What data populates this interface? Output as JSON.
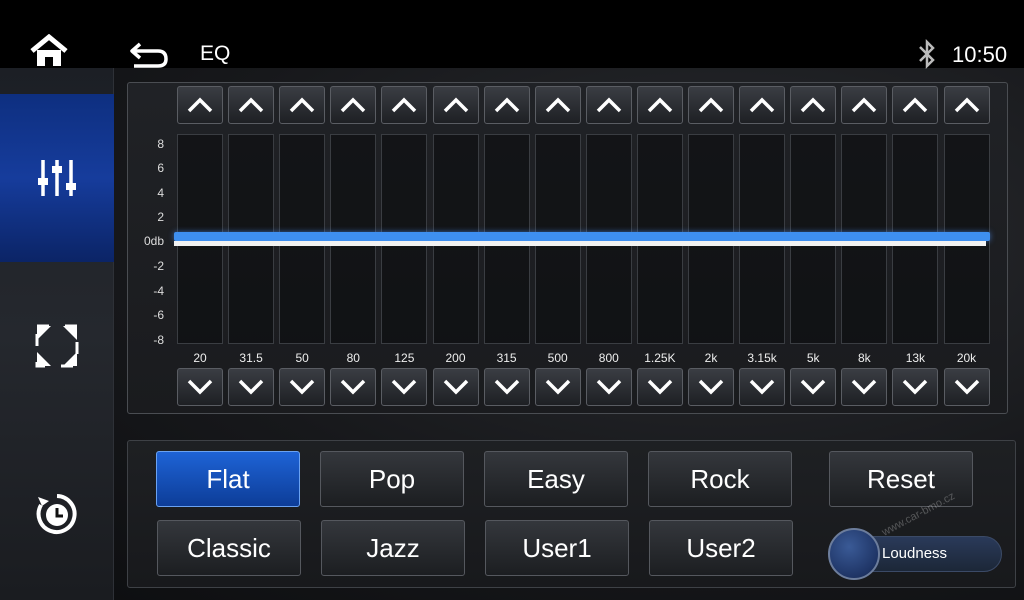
{
  "header": {
    "title": "EQ",
    "time": "10:50",
    "home_icon": "home-icon",
    "back_icon": "back-arrow-icon",
    "bluetooth_icon": "bluetooth-icon"
  },
  "sidebar": {
    "items": [
      {
        "icon": "equalizer-sliders-icon",
        "active": true
      },
      {
        "icon": "fullscreen-corners-icon",
        "active": false
      },
      {
        "icon": "clock-timer-icon",
        "active": false
      }
    ]
  },
  "eq": {
    "db_scale": [
      "8",
      "6",
      "4",
      "2",
      "0db",
      "-2",
      "-4",
      "-6",
      "-8"
    ],
    "bands": [
      {
        "freq": "20",
        "gain_db": 0
      },
      {
        "freq": "31.5",
        "gain_db": 0
      },
      {
        "freq": "50",
        "gain_db": 0
      },
      {
        "freq": "80",
        "gain_db": 0
      },
      {
        "freq": "125",
        "gain_db": 0
      },
      {
        "freq": "200",
        "gain_db": 0
      },
      {
        "freq": "315",
        "gain_db": 0
      },
      {
        "freq": "500",
        "gain_db": 0
      },
      {
        "freq": "800",
        "gain_db": 0
      },
      {
        "freq": "1.25K",
        "gain_db": 0
      },
      {
        "freq": "2k",
        "gain_db": 0
      },
      {
        "freq": "3.15k",
        "gain_db": 0
      },
      {
        "freq": "5k",
        "gain_db": 0
      },
      {
        "freq": "8k",
        "gain_db": 0
      },
      {
        "freq": "13k",
        "gain_db": 0
      },
      {
        "freq": "20k",
        "gain_db": 0
      }
    ],
    "accent_color": "#3e8ff0"
  },
  "presets": {
    "row1": [
      "Flat",
      "Pop",
      "Easy",
      "Rock"
    ],
    "row2": [
      "Classic",
      "Jazz",
      "User1",
      "User2"
    ],
    "reset": "Reset",
    "selected": "Flat",
    "selected_color": "#1e63d6"
  },
  "loudness": {
    "label": "Loudness",
    "on": false
  },
  "watermark": "www.car-bmo.cz"
}
